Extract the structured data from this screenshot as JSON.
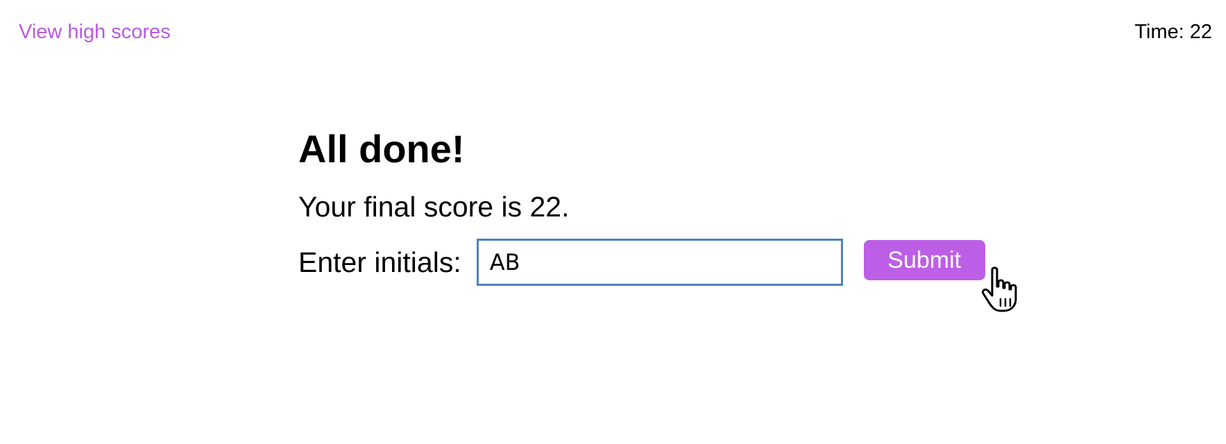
{
  "header": {
    "high_scores_link": "View high scores",
    "timer_label": "Time:",
    "timer_value": "22"
  },
  "result": {
    "title": "All done!",
    "score_text": "Your final score is 22."
  },
  "form": {
    "initials_label": "Enter initials:",
    "initials_value": "AB",
    "submit_label": "Submit"
  },
  "colors": {
    "link": "#b95ae0",
    "button": "#bd5fe6",
    "input_border": "#4a82c4"
  },
  "icons": {
    "cursor": "hand-pointer-icon"
  }
}
